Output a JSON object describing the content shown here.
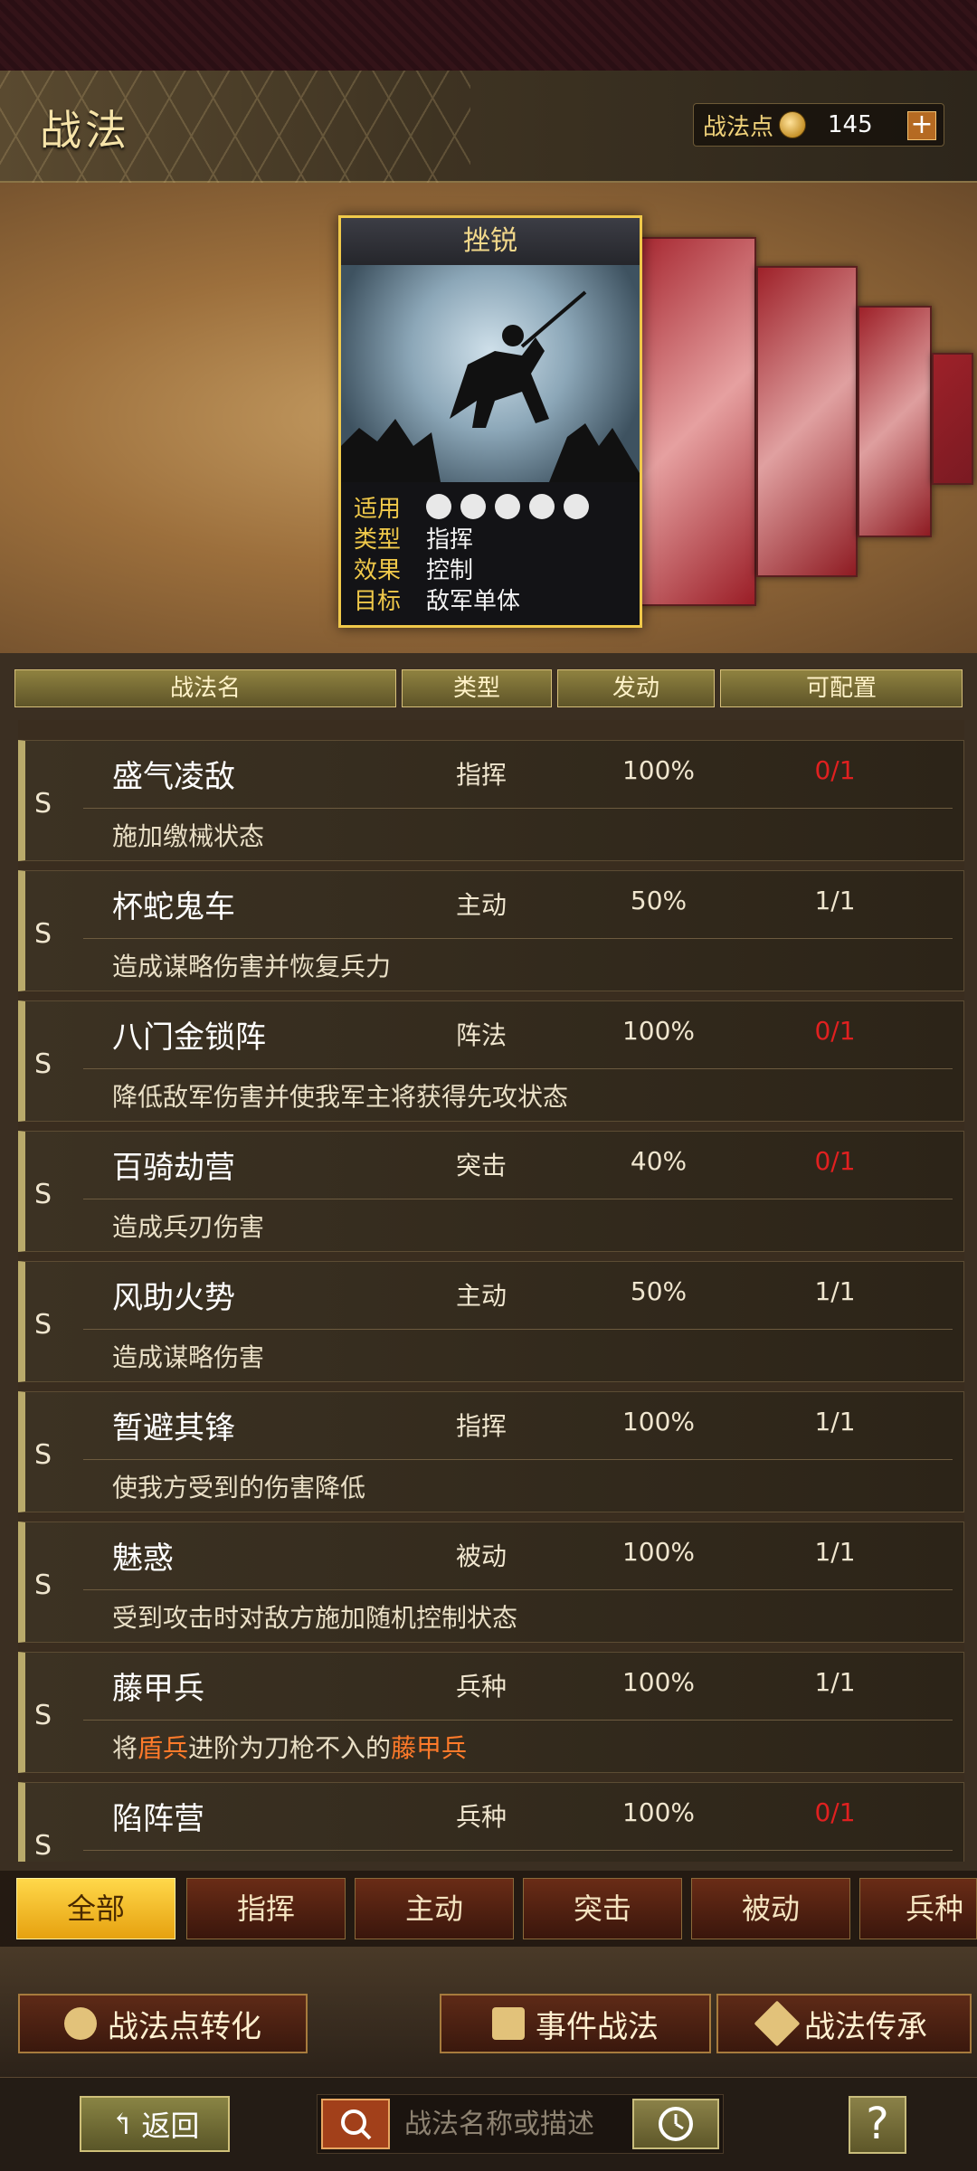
{
  "header": {
    "title": "战法",
    "points_label": "战法点",
    "points_value": "145",
    "plus_label": "+"
  },
  "featured_card": {
    "title": "挫锐",
    "rows": [
      {
        "key": "适用",
        "value": ""
      },
      {
        "key": "类型",
        "value": "指挥"
      },
      {
        "key": "效果",
        "value": "控制"
      },
      {
        "key": "目标",
        "value": "敌军单体"
      }
    ],
    "unit_icons": [
      "cavalry-icon",
      "shield-icon",
      "bow-icon",
      "spear-icon",
      "chariot-icon"
    ]
  },
  "columns": [
    "战法名",
    "类型",
    "发动",
    "可配置"
  ],
  "skills": [
    {
      "grade": "S",
      "name": "盛气凌敌",
      "type": "指挥",
      "rate": "100%",
      "slots": "0/1",
      "desc": "施加缴械状态",
      "slots_color": "#e02020"
    },
    {
      "grade": "S",
      "name": "杯蛇鬼车",
      "type": "主动",
      "rate": "50%",
      "slots": "1/1",
      "desc": "造成谋略伤害并恢复兵力",
      "slots_color": "#f0e6cf"
    },
    {
      "grade": "S",
      "name": "八门金锁阵",
      "type": "阵法",
      "rate": "100%",
      "slots": "0/1",
      "desc": "降低敌军伤害并使我军主将获得先攻状态",
      "slots_color": "#e02020"
    },
    {
      "grade": "S",
      "name": "百骑劫营",
      "type": "突击",
      "rate": "40%",
      "slots": "0/1",
      "desc": "造成兵刃伤害",
      "slots_color": "#e02020"
    },
    {
      "grade": "S",
      "name": "风助火势",
      "type": "主动",
      "rate": "50%",
      "slots": "1/1",
      "desc": "造成谋略伤害",
      "slots_color": "#f0e6cf"
    },
    {
      "grade": "S",
      "name": "暂避其锋",
      "type": "指挥",
      "rate": "100%",
      "slots": "1/1",
      "desc": "使我方受到的伤害降低",
      "slots_color": "#f0e6cf"
    },
    {
      "grade": "S",
      "name": "魅惑",
      "type": "被动",
      "rate": "100%",
      "slots": "1/1",
      "desc": "受到攻击时对敌方施加随机控制状态",
      "slots_color": "#f0e6cf"
    },
    {
      "grade": "S",
      "name": "藤甲兵",
      "type": "兵种",
      "rate": "100%",
      "slots": "1/1",
      "desc_parts": [
        "将",
        "盾兵",
        "进阶为刀枪不入的",
        "藤甲兵"
      ],
      "slots_color": "#f0e6cf"
    },
    {
      "grade": "S",
      "name": "陷阵营",
      "type": "兵种",
      "rate": "100%",
      "slots": "0/1",
      "desc": "",
      "slots_color": "#e02020"
    }
  ],
  "filter_tabs": [
    "全部",
    "指挥",
    "主动",
    "突击",
    "被动",
    "兵种"
  ],
  "actions": {
    "convert": "战法点转化",
    "event": "事件战法",
    "inherit": "战法传承"
  },
  "bottom": {
    "back": "返回",
    "search_placeholder": "战法名称或描述",
    "help": "?"
  }
}
